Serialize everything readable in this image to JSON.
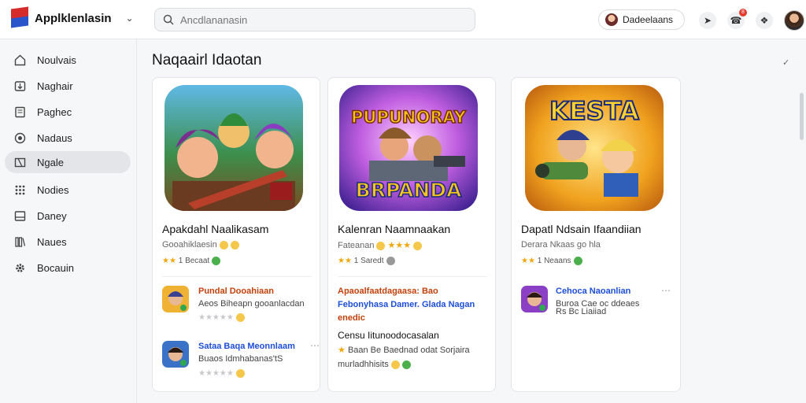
{
  "app": {
    "name": "Applklenlasin"
  },
  "search": {
    "placeholder": "Ancdlananasin"
  },
  "user": {
    "chip_label": "Dadeelaans"
  },
  "notifications": {
    "count": "8"
  },
  "sidebar": {
    "items": [
      {
        "label": "Noulvais",
        "icon": "home-icon"
      },
      {
        "label": "Naghair",
        "icon": "download-icon"
      },
      {
        "label": "Paghec",
        "icon": "page-icon"
      },
      {
        "label": "Nadaus",
        "icon": "compass-icon"
      },
      {
        "label": "Ngale",
        "icon": "film-icon",
        "active": true
      },
      {
        "label": "Nodies",
        "icon": "grid-icon"
      },
      {
        "label": "Daney",
        "icon": "inbox-icon"
      },
      {
        "label": "Naues",
        "icon": "books-icon"
      },
      {
        "label": "Bocauin",
        "icon": "gear-icon"
      }
    ]
  },
  "main": {
    "title": "Naqaairl Idaotan",
    "collapse_icon": "check-icon"
  },
  "cards": [
    {
      "name": "Apakdahl Naalikasam",
      "subtitle": "Gooahiklaesin",
      "rating": "Becaat",
      "icon_title": "",
      "related": [
        {
          "title": "Pundal Dooahiaan",
          "sub": "Aeos Biheapn gooanlacdan",
          "title_color": "#c2410c"
        },
        {
          "title": "Sataa Baqa Meonnlaam",
          "sub": "Buaos Idmhabanas'tS",
          "title_color": "#1d4ed8"
        }
      ]
    },
    {
      "name": "Kalenran Naamnaakan",
      "subtitle": "Fateanan",
      "rating": "Saredt",
      "icon_title": "PUPUNORAY",
      "icon_subtitle": "BRPANDA",
      "related_text": [
        {
          "text": "Apaoalfaatdagaasa: Bao",
          "color": "#c2410c"
        },
        {
          "text": "Febonyhasa Damer. Glada Nagan",
          "color": "#1d4ed8"
        },
        {
          "text": "enedic",
          "color": "#c2410c"
        },
        {
          "text": "Censu Iitunoodocasalan",
          "color": "#111"
        },
        {
          "text": "Baan Be Baednad odat Sorjaira",
          "color": "#444"
        },
        {
          "text": "murladhhisits",
          "color": "#444"
        }
      ]
    },
    {
      "name": "Dapatl Ndsain Ifaandiian",
      "subtitle": "Derara Nkaas go hla",
      "rating": "Neaans",
      "icon_title": "KESTA",
      "related": [
        {
          "title": "Cehoca Naoanlian",
          "sub": "Buroa Cae oc ddeaes",
          "title_color": "#1d4ed8"
        },
        {
          "title": "",
          "sub": "Rs Bc Liaiiad",
          "title_color": "#111"
        }
      ]
    }
  ],
  "colors": {
    "accent": "#2a54c9",
    "star": "#f2a60c",
    "brand_red": "#d62b2b"
  }
}
